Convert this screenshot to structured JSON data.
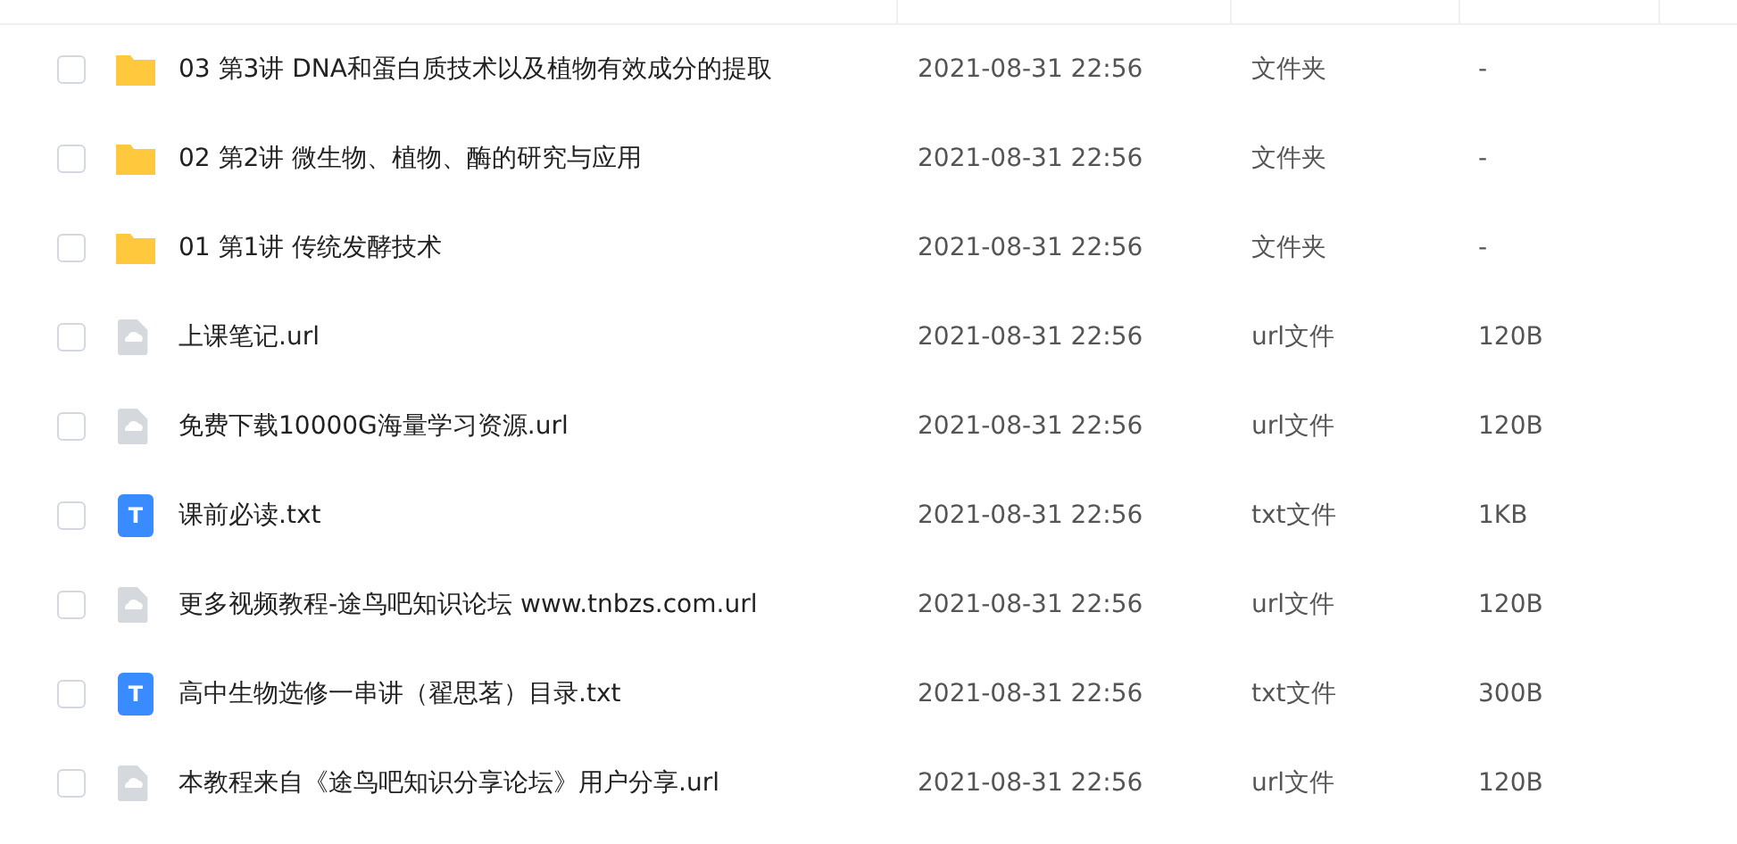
{
  "files": [
    {
      "name": "03 第3讲 DNA和蛋白质技术以及植物有效成分的提取",
      "modified": "2021-08-31 22:56",
      "type": "文件夹",
      "size": "-",
      "kind": "folder",
      "checked": false
    },
    {
      "name": "02 第2讲 微生物、植物、酶的研究与应用",
      "modified": "2021-08-31 22:56",
      "type": "文件夹",
      "size": "-",
      "kind": "folder",
      "checked": false
    },
    {
      "name": "01 第1讲 传统发酵技术",
      "modified": "2021-08-31 22:56",
      "type": "文件夹",
      "size": "-",
      "kind": "folder",
      "checked": false
    },
    {
      "name": "上课笔记.url",
      "modified": "2021-08-31 22:56",
      "type": "url文件",
      "size": "120B",
      "kind": "link",
      "checked": false
    },
    {
      "name": "免费下载10000G海量学习资源.url",
      "modified": "2021-08-31 22:56",
      "type": "url文件",
      "size": "120B",
      "kind": "link",
      "checked": false
    },
    {
      "name": "课前必读.txt",
      "modified": "2021-08-31 22:56",
      "type": "txt文件",
      "size": "1KB",
      "kind": "text",
      "icon_glyph": "T",
      "checked": false
    },
    {
      "name": "更多视频教程-途鸟吧知识论坛 www.tnbzs.com.url",
      "modified": "2021-08-31 22:56",
      "type": "url文件",
      "size": "120B",
      "kind": "link",
      "checked": false
    },
    {
      "name": "高中生物选修一串讲（翟思茗）目录.txt",
      "modified": "2021-08-31 22:56",
      "type": "txt文件",
      "size": "300B",
      "kind": "text",
      "icon_glyph": "T",
      "checked": false
    },
    {
      "name": "本教程来自《途鸟吧知识分享论坛》用户分享.url",
      "modified": "2021-08-31 22:56",
      "type": "url文件",
      "size": "120B",
      "kind": "link",
      "checked": false
    }
  ]
}
